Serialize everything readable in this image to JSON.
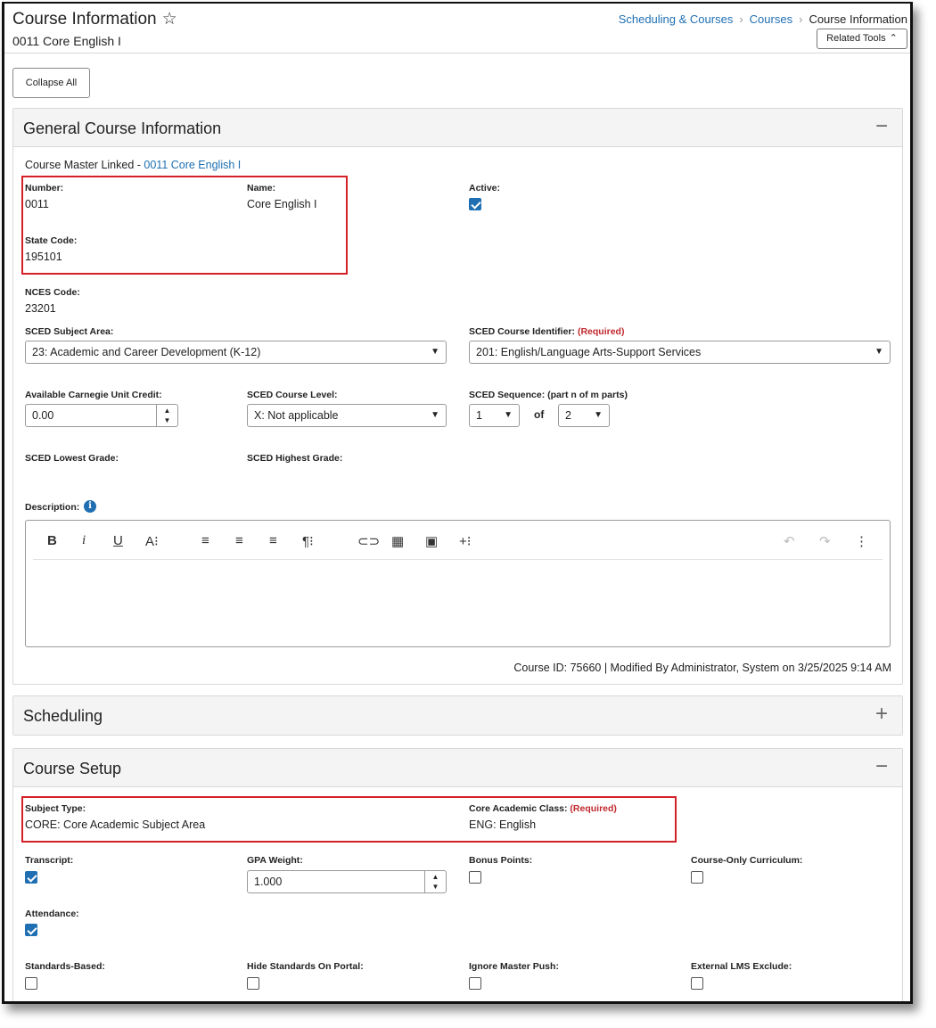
{
  "header": {
    "title": "Course Information",
    "star_icon": "star-outline-icon",
    "subtitle": "0011 Core English I",
    "breadcrumbs": [
      "Scheduling & Courses",
      "Courses",
      "Course Information"
    ],
    "related_tools": "Related Tools"
  },
  "collapse_all": "Collapse All",
  "general": {
    "title": "General Course Information",
    "toggle": "−",
    "master_linked_label": "Course Master Linked - ",
    "master_linked_link": "0011 Core English I",
    "number_label": "Number:",
    "number": "0011",
    "name_label": "Name:",
    "name": "Core English I",
    "active_label": "Active:",
    "active": true,
    "state_code_label": "State Code:",
    "state_code": "195101",
    "nces_label": "NCES Code:",
    "nces": "23201",
    "subject_area_label": "SCED Subject Area:",
    "subject_area": "23: Academic and Career Development (K-12)",
    "course_identifier_label": "SCED Course Identifier:",
    "required": "(Required)",
    "course_identifier": "201: English/Language Arts-Support Services",
    "carnegie_label": "Available Carnegie Unit Credit:",
    "carnegie": "0.00",
    "course_level_label": "SCED Course Level:",
    "course_level": "X: Not applicable",
    "sequence_label": "SCED Sequence: (part n of m parts)",
    "sequence_n": "1",
    "of": "of",
    "sequence_m": "2",
    "lowest_grade_label": "SCED Lowest Grade:",
    "highest_grade_label": "SCED Highest Grade:",
    "description_label": "Description:",
    "footer": "Course ID: 75660 | Modified By Administrator, System on 3/25/2025 9:14 AM"
  },
  "scheduling": {
    "title": "Scheduling",
    "toggle": "+"
  },
  "setup": {
    "title": "Course Setup",
    "toggle": "−",
    "subject_type_label": "Subject Type:",
    "subject_type": "CORE: Core Academic Subject Area",
    "core_class_label": "Core Academic Class:",
    "required": "(Required)",
    "core_class": "ENG: English",
    "transcript_label": "Transcript:",
    "transcript": true,
    "gpa_label": "GPA Weight:",
    "gpa": "1.000",
    "bonus_label": "Bonus Points:",
    "bonus": false,
    "curriculum_label": "Course-Only Curriculum:",
    "curriculum": false,
    "attendance_label": "Attendance:",
    "attendance": true,
    "standards_label": "Standards-Based:",
    "hide_standards_label": "Hide Standards On Portal:",
    "ignore_push_label": "Ignore Master Push:",
    "lms_exclude_label": "External LMS Exclude:"
  },
  "colors": {
    "accent": "#1f6fb2",
    "required": "#c0282d",
    "highlight": "#d42027"
  }
}
